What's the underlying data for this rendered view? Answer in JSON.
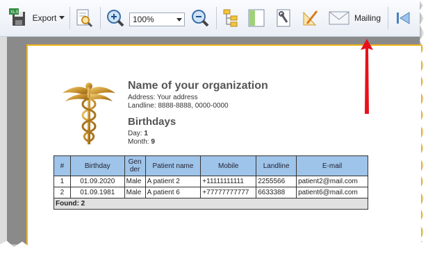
{
  "toolbar": {
    "export_label": "Export",
    "zoom_value": "100%",
    "mailing_label": "Mailing",
    "icons": [
      "xls-save-icon",
      "report-preview-icon",
      "zoom-in-icon",
      "zoom-out-icon",
      "tree-icon",
      "panel-icon",
      "wrench-icon",
      "design-icon",
      "envelope-icon",
      "first-page-icon"
    ]
  },
  "report": {
    "org_name": "Name of your organization",
    "address": "Address: Your address",
    "landline": "Landline: 8888-8888, 0000-0000",
    "title": "Birthdays",
    "day_label": "Day: ",
    "day_value": "1",
    "month_label": "Month: ",
    "month_value": "9",
    "columns": [
      "#",
      "Birthday",
      "Gen der",
      "Patient name",
      "Mobile",
      "Landline",
      "E-mail"
    ],
    "rows": [
      {
        "num": "1",
        "birthday": "01.09.2020",
        "gender": "Male",
        "name": "A patient 2",
        "mobile": "+11111111111",
        "landline": "2255566",
        "email": "patient2@mail.com"
      },
      {
        "num": "2",
        "birthday": "01.09.1981",
        "gender": "Male",
        "name": "A patient 6",
        "mobile": "+77777777777",
        "landline": "6633388",
        "email": "patient6@mail.com"
      }
    ],
    "found": "Found: 2"
  },
  "colors": {
    "header_bg": "#9fc4e9",
    "page_border": "#f3b515",
    "arrow": "#e8101a"
  }
}
